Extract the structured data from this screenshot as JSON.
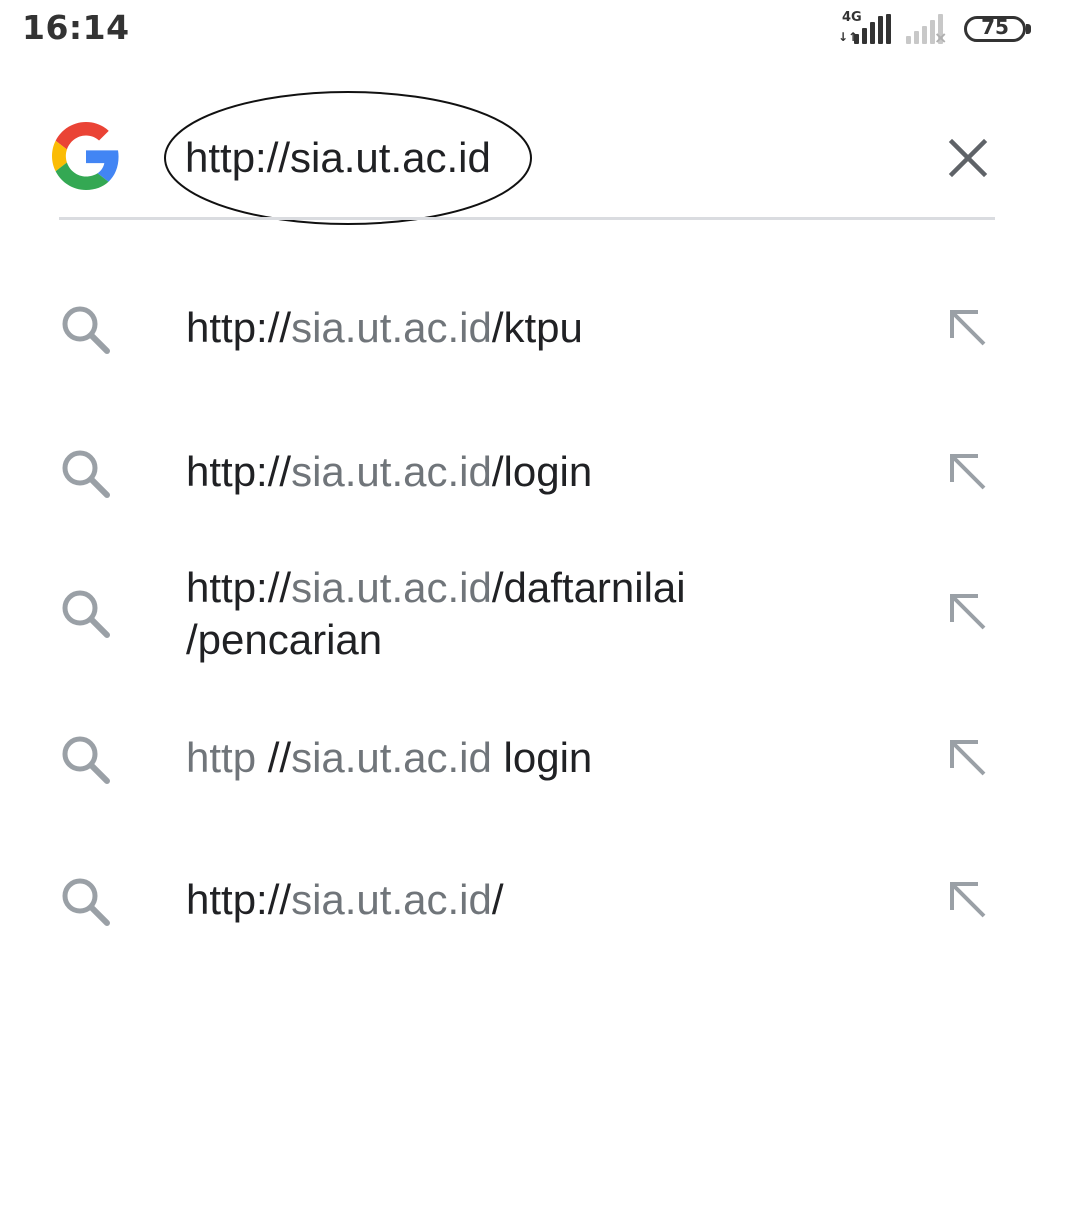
{
  "status_bar": {
    "time": "16:14",
    "network_type": "4G",
    "data_arrows": "↓↑",
    "battery_level": "75",
    "icons": {
      "signal_primary": "signal-bars-icon",
      "signal_secondary": "signal-no-sim-icon",
      "battery": "battery-icon"
    }
  },
  "search": {
    "logo": "google-g-icon",
    "query": "http://sia.ut.ac.id",
    "clear_icon": "close-icon",
    "colors": {
      "google_blue": "#4285F4",
      "google_red": "#EA4335",
      "google_yellow": "#FBBC05",
      "google_green": "#34A853"
    }
  },
  "suggestions": [
    {
      "line1": {
        "prefix": "http://",
        "muted": "sia.ut.ac.id",
        "suffix": "/ktpu"
      },
      "line2": "",
      "icon": "search-icon",
      "fill_icon": "arrow-up-left-icon"
    },
    {
      "line1": {
        "prefix": "http://",
        "muted": "sia.ut.ac.id",
        "suffix": "/login"
      },
      "line2": "",
      "icon": "search-icon",
      "fill_icon": "arrow-up-left-icon"
    },
    {
      "line1": {
        "prefix": "http://",
        "muted": "sia.ut.ac.id",
        "suffix": "/daftarnilai"
      },
      "line2": "/pencarian",
      "icon": "search-icon",
      "fill_icon": "arrow-up-left-icon"
    },
    {
      "line1": {
        "muted_lead": "http ",
        "prefix": "//",
        "muted": "sia.ut.ac.id",
        "suffix": " login"
      },
      "line2": "",
      "icon": "search-icon",
      "fill_icon": "arrow-up-left-icon"
    },
    {
      "line1": {
        "prefix": "http://",
        "muted": "sia.ut.ac.id",
        "suffix": "/"
      },
      "line2": "",
      "icon": "search-icon",
      "fill_icon": "arrow-up-left-icon"
    }
  ],
  "colors": {
    "text_primary": "#202124",
    "text_muted": "#70757a",
    "icon_gray": "#9aa0a6",
    "divider": "#dadce0"
  }
}
